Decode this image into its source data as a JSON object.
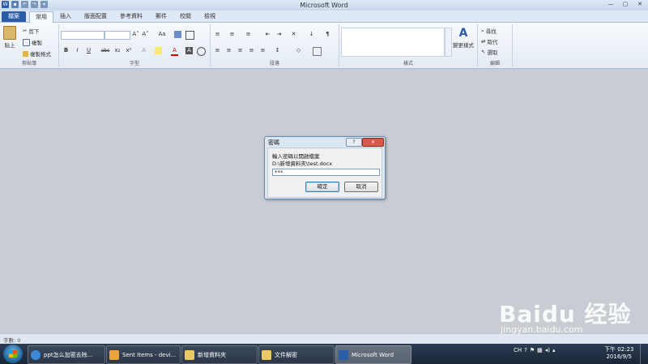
{
  "app": {
    "title": "Microsoft Word",
    "tabs": [
      "檔案",
      "常用",
      "插入",
      "版面配置",
      "參考資料",
      "郵件",
      "校閱",
      "檢視"
    ],
    "window_controls": [
      "—",
      "▢",
      "✕"
    ]
  },
  "ribbon": {
    "clipboard": {
      "paste": "貼上",
      "cut": "剪下",
      "copy": "複製",
      "format_painter": "複製格式",
      "label": "剪貼簿"
    },
    "font": {
      "bold": "B",
      "italic": "I",
      "underline": "U",
      "strike": "abc",
      "sub": "x₂",
      "sup": "x²",
      "grow": "A˄",
      "shrink": "A˅",
      "case": "Aa",
      "font_color": "A",
      "label": "字型"
    },
    "paragraph": {
      "label": "段落"
    },
    "styles": {
      "change": "變更樣式",
      "label": "樣式"
    },
    "editing": {
      "find": "尋找",
      "replace": "取代",
      "select": "選取",
      "label": "編輯"
    }
  },
  "dialog": {
    "title": "密碼",
    "help": "?",
    "close": "✕",
    "prompt": "輸入密碼以開啟檔案",
    "filepath": "D:\\新增資料夾\\test.docx",
    "password_masked": "***",
    "ok": "確定",
    "cancel": "取消"
  },
  "status": {
    "words": "字數: 0"
  },
  "taskbar": {
    "items": [
      {
        "label": "ppt怎么加密去除..."
      },
      {
        "label": "Sent Items - devi..."
      },
      {
        "label": "新增資料夾"
      },
      {
        "label": "文件解密"
      },
      {
        "label": "Microsoft Word"
      }
    ],
    "ime": "CH",
    "time": "下午 02:23",
    "date": "2016/9/5"
  },
  "watermark": {
    "brand": "Baidu 经验",
    "url": "jingyan.baidu.com"
  },
  "colors": {
    "file_tab": "#2a5ca8",
    "close_button": "#d65a49",
    "taskbar": "#1a2638",
    "workspace": "#c9ccd2"
  }
}
